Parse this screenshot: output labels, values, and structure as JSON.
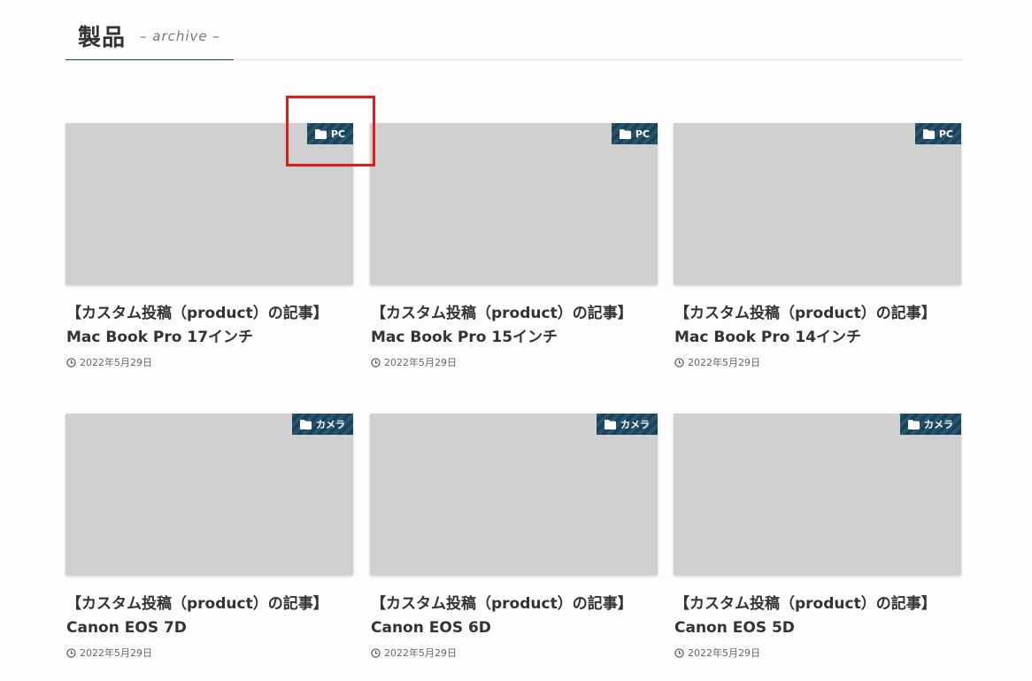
{
  "archive": {
    "title": "製品",
    "subtitle": "– archive –"
  },
  "colors": {
    "badge": "#17445c",
    "thumbnail": "#d0d0d0",
    "highlight": "#e01b1b"
  },
  "cards": [
    {
      "category": "PC",
      "title_line1": "【カスタム投稿（product）の記事】",
      "title_line2": "Mac Book Pro 17インチ",
      "date": "2022年5月29日"
    },
    {
      "category": "PC",
      "title_line1": "【カスタム投稿（product）の記事】",
      "title_line2": "Mac Book Pro 15インチ",
      "date": "2022年5月29日"
    },
    {
      "category": "PC",
      "title_line1": "【カスタム投稿（product）の記事】",
      "title_line2": "Mac Book Pro 14インチ",
      "date": "2022年5月29日"
    },
    {
      "category": "カメラ",
      "title_line1": "【カスタム投稿（product）の記事】",
      "title_line2": "Canon EOS 7D",
      "date": "2022年5月29日"
    },
    {
      "category": "カメラ",
      "title_line1": "【カスタム投稿（product）の記事】",
      "title_line2": "Canon EOS 6D",
      "date": "2022年5月29日"
    },
    {
      "category": "カメラ",
      "title_line1": "【カスタム投稿（product）の記事】",
      "title_line2": "Canon EOS 5D",
      "date": "2022年5月29日"
    }
  ]
}
